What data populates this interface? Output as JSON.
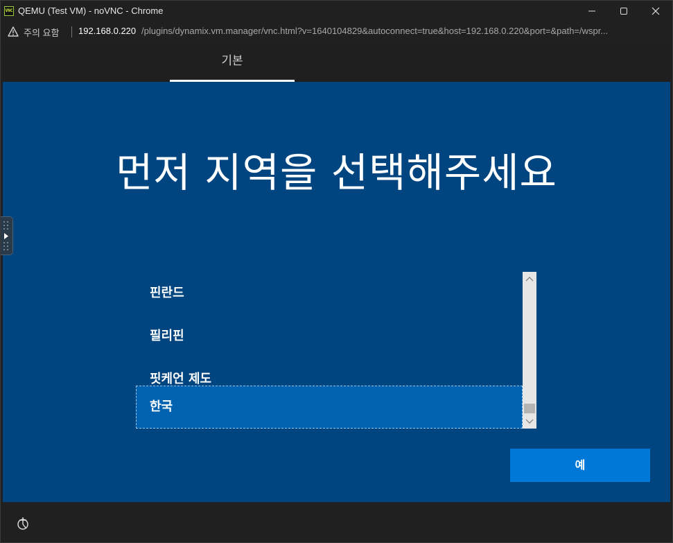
{
  "window": {
    "title": "QEMU (Test VM) - noVNC - Chrome",
    "logo_text": "VNC"
  },
  "addressbar": {
    "warning_label": "주의 요함",
    "host": "192.168.0.220",
    "path": "/plugins/dynamix.vm.manager/vnc.html?v=1640104829&autoconnect=true&host=192.168.0.220&port=&path=/wspr..."
  },
  "vm_tabs": {
    "active_tab": "기본"
  },
  "oobe": {
    "heading": "먼저 지역을 선택해주세요",
    "regions": [
      "핀란드",
      "필리핀",
      "핏케언 제도",
      "한국"
    ],
    "selected_region": "한국",
    "confirm_button": "예"
  },
  "colors": {
    "oobe_background": "#004580",
    "selection": "#0063b1",
    "button": "#0078d7"
  }
}
